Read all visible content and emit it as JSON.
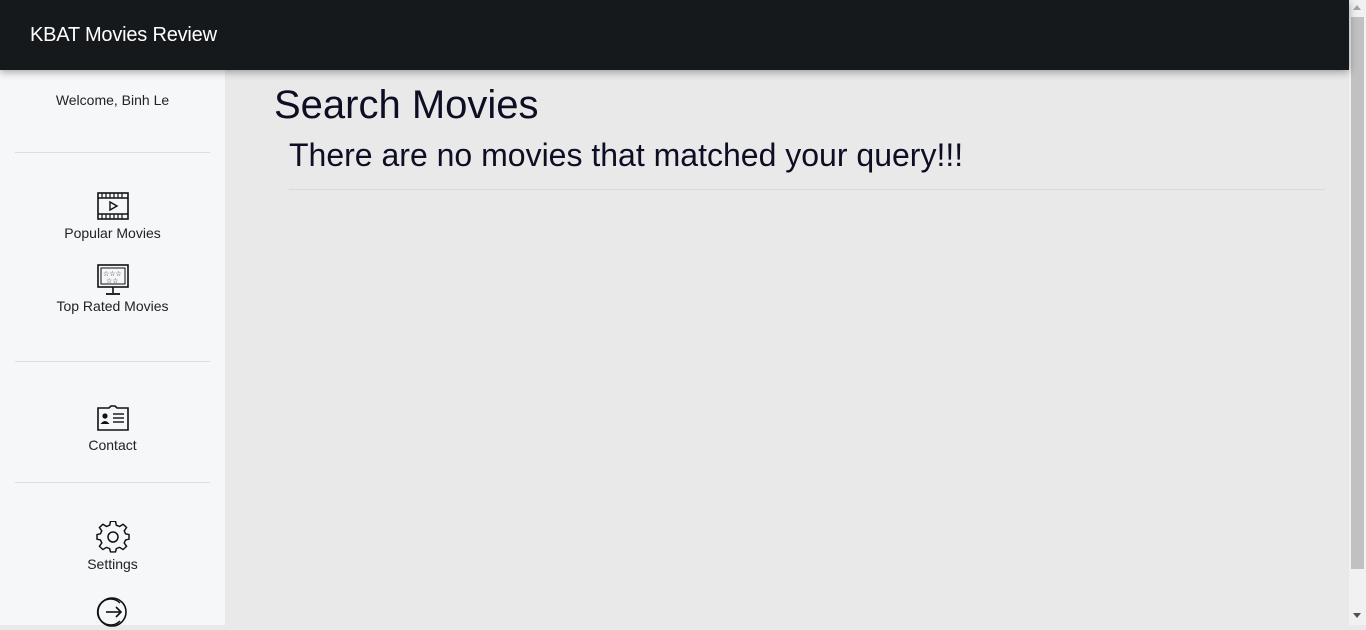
{
  "app": {
    "title": "KBAT Movies Review"
  },
  "sidebar": {
    "welcome": "Welcome, Binh Le",
    "items": [
      {
        "label": "Popular Movies",
        "icon": "film-play-icon"
      },
      {
        "label": "Top Rated Movies",
        "icon": "monitor-stars-icon"
      },
      {
        "label": "Contact",
        "icon": "contact-card-icon"
      },
      {
        "label": "Settings",
        "icon": "gear-icon"
      },
      {
        "label": "",
        "icon": "logout-icon"
      }
    ]
  },
  "main": {
    "title": "Search Movies",
    "message": "There are no movies that matched your query!!!"
  },
  "colors": {
    "navbar": "#16191c",
    "sidebar": "#f6f7f9",
    "content": "#e9e9e9",
    "text": "#0d0d24"
  }
}
